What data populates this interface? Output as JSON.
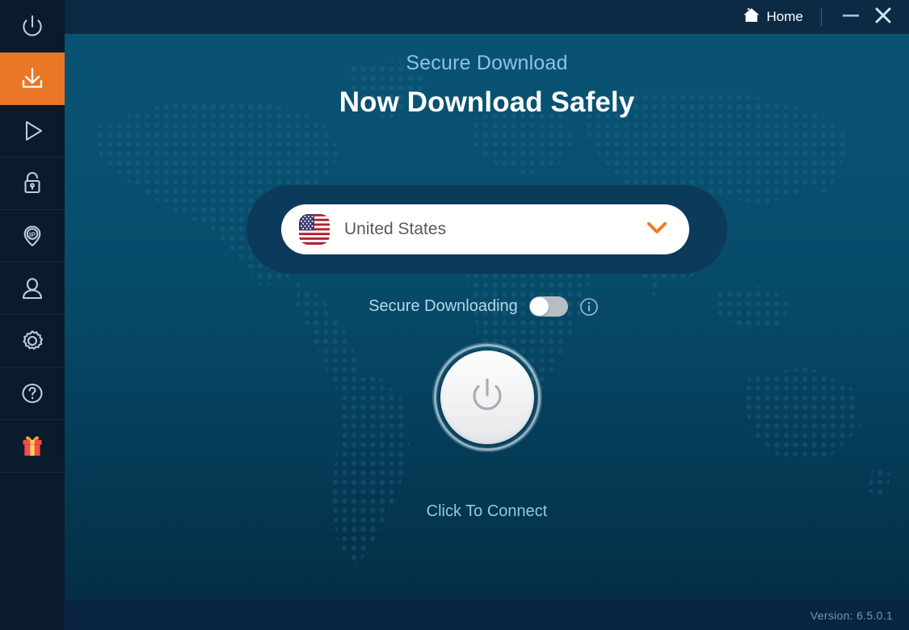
{
  "app": {
    "accent_color": "#e97726",
    "background_top_color": "#075271",
    "background_bottom_color": "#032c43",
    "sidebar_color": "#0a1b2b",
    "titlebar_color": "#0d2a44",
    "footer_color": "#082441"
  },
  "titlebar": {
    "home_label": "Home",
    "home_icon": "home-icon",
    "minimize_icon": "minimize-icon",
    "close_icon": "close-icon"
  },
  "sidebar": {
    "items": [
      {
        "name": "power",
        "icon": "power-icon",
        "active": false
      },
      {
        "name": "download",
        "icon": "download-icon",
        "active": true
      },
      {
        "name": "streaming",
        "icon": "play-icon",
        "active": false
      },
      {
        "name": "security",
        "icon": "lock-icon",
        "active": false
      },
      {
        "name": "ip-address",
        "icon": "ip-pin-icon",
        "active": false
      },
      {
        "name": "account",
        "icon": "user-icon",
        "active": false
      },
      {
        "name": "settings",
        "icon": "gear-icon",
        "active": false
      },
      {
        "name": "help",
        "icon": "question-icon",
        "active": false
      },
      {
        "name": "rewards",
        "icon": "gift-icon",
        "active": false
      }
    ]
  },
  "main": {
    "subtitle": "Secure Download",
    "headline": "Now Download Safely",
    "country_select": {
      "selected": "United States",
      "flag_icon": "us-flag-icon",
      "chevron_icon": "chevron-down-icon",
      "chevron_color": "#f07c1f"
    },
    "secure_toggle": {
      "label": "Secure Downloading",
      "state": "off",
      "info_icon": "info-icon"
    },
    "power_button": {
      "icon": "power-icon",
      "state": "disconnected"
    },
    "connect_text": "Click To Connect"
  },
  "footer": {
    "version_label": "Version:",
    "version_value": "6.5.0.1",
    "version_full": "Version:  6.5.0.1"
  }
}
